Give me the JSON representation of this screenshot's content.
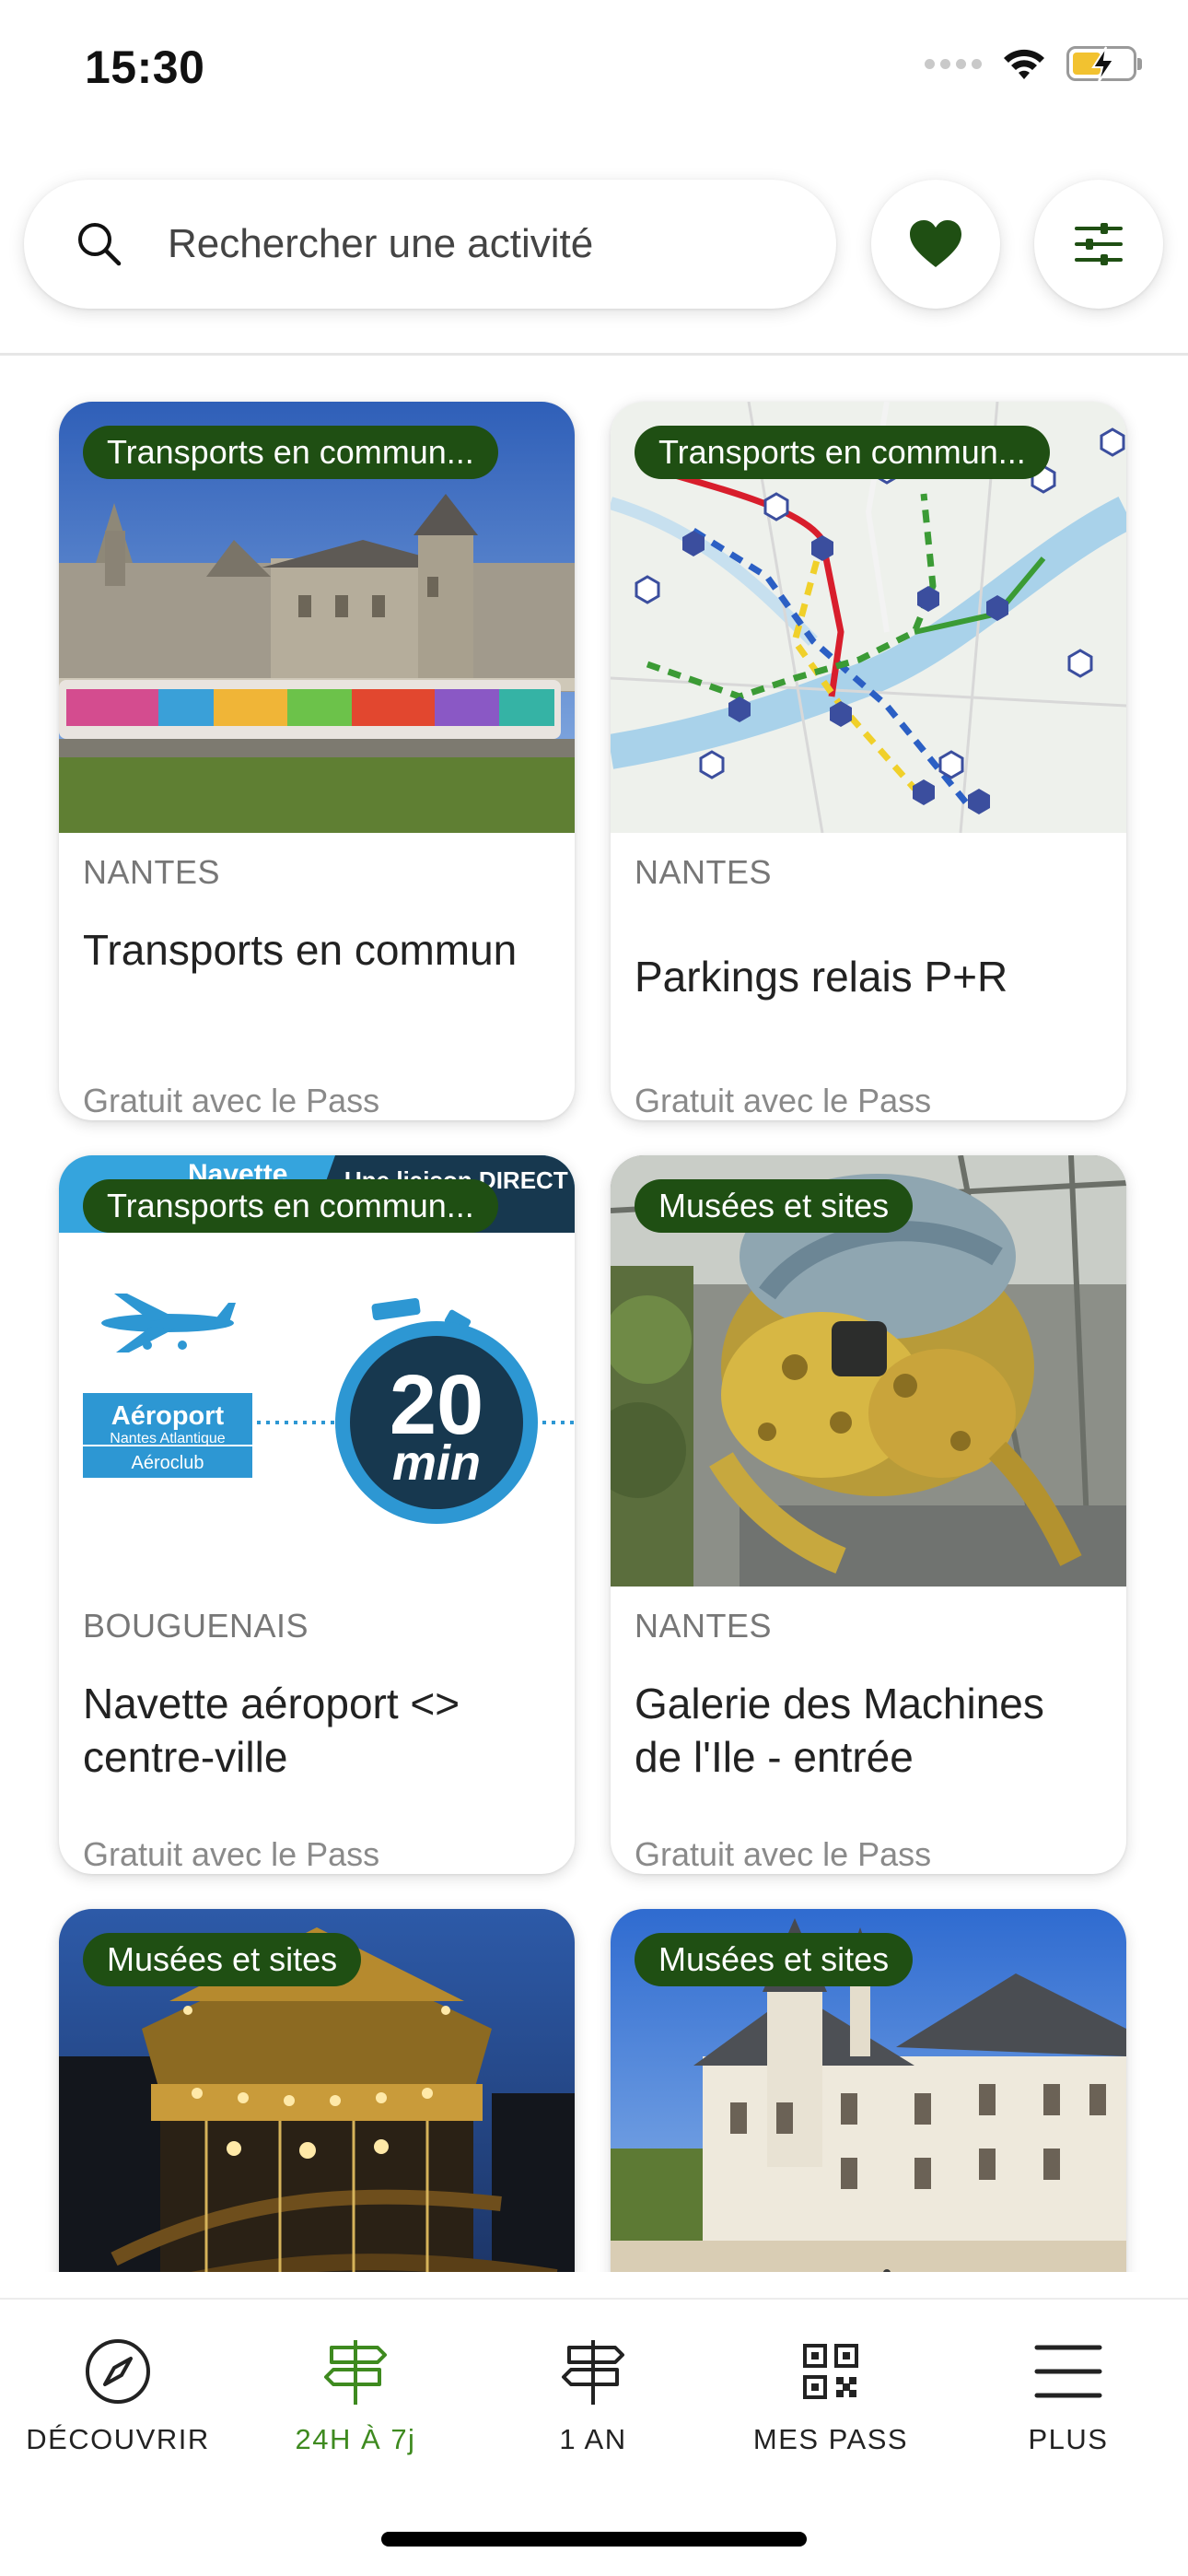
{
  "status_bar": {
    "time": "15:30"
  },
  "search": {
    "placeholder": "Rechercher une activité"
  },
  "colors": {
    "accent_green": "#1f4f13",
    "active_tab": "#3e8a1f"
  },
  "cards": [
    {
      "tag": "Transports en commun...",
      "city": "NANTES",
      "title": "Transports en commun",
      "footer": "Gratuit avec le Pass"
    },
    {
      "tag": "Transports en commun...",
      "city": "NANTES",
      "title": "Parkings relais P+R",
      "footer": "Gratuit avec le Pass"
    },
    {
      "tag": "Transports en commun...",
      "city": "BOUGUENAIS",
      "title": "Navette aéroport <> centre-ville",
      "footer": "Gratuit avec le Pass",
      "image_text": {
        "banner_left": "Navette",
        "banner_right": "Une liaison DIRECT",
        "airport": "Aéroport",
        "airport_sub": "Nantes Atlantique",
        "aeroclub": "Aéroclub",
        "timer_num": "20",
        "timer_unit": "min"
      }
    },
    {
      "tag": "Musées et sites",
      "city": "NANTES",
      "title": "Galerie des Machines de l'Ile - entrée",
      "footer": "Gratuit avec le Pass"
    },
    {
      "tag": "Musées et sites"
    },
    {
      "tag": "Musées et sites"
    }
  ],
  "tabs": [
    {
      "label": "DÉCOUVRIR",
      "icon": "compass-icon"
    },
    {
      "label": "24H À 7j",
      "icon": "signpost-icon",
      "active": true
    },
    {
      "label": "1 AN",
      "icon": "signpost-icon"
    },
    {
      "label": "MES PASS",
      "icon": "qr-code-icon"
    },
    {
      "label": "PLUS",
      "icon": "menu-icon"
    }
  ]
}
